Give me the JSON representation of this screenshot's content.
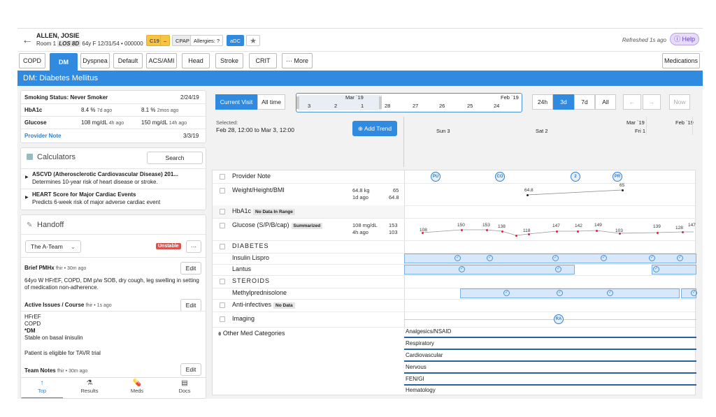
{
  "header": {
    "patient_name": "ALLEN, JOSIE",
    "room": "Room 1",
    "los": "LOS 8D",
    "demographics": "64y F 12/31/54 • 000000",
    "tags": [
      "C19",
      "–",
      "CPAP",
      "Allergies: ?",
      "aDC"
    ],
    "refreshed": "Refreshed 1s ago",
    "help": "Help"
  },
  "tabs": [
    "COPD",
    "DM",
    "Dyspnea",
    "Default",
    "ACS/AMI",
    "Head",
    "Stroke",
    "CRIT",
    "··· More"
  ],
  "medications_button": "Medications",
  "banner": "DM: Diabetes Mellitus",
  "summary": {
    "smoking": "Smoking Status: Never Smoker",
    "smoking_date": "2/24/19",
    "hba1c_label": "HbA1c",
    "hba1c_v1": "8.4 %",
    "hba1c_t1": "7d ago",
    "hba1c_v2": "8.1 %",
    "hba1c_t2": "2mos ago",
    "glucose_label": "Glucose",
    "glucose_v1": "108 mg/dL",
    "glucose_t1": "4h ago",
    "glucose_v2": "150 mg/dL",
    "glucose_t2": "14h ago",
    "provider_note": "Provider Note",
    "provider_date": "3/3/19"
  },
  "calculators": {
    "title": "Calculators",
    "search": "Search",
    "items": [
      {
        "title": "ASCVD (Atherosclerotic Cardiovascular Disease) 201...",
        "desc": "Determines 10-year risk of heart disease or stroke."
      },
      {
        "title": "HEART Score for Major Cardiac Events",
        "desc": "Predicts 6-week risk of major adverse cardiac event"
      }
    ]
  },
  "handoff": {
    "title": "Handoff",
    "team": "The A-Team",
    "status": "Unstable",
    "more": "···",
    "pmhx_label": "Brief PMHx",
    "pmhx_meta": "fhir • 30m ago",
    "pmhx_text": "64yo W HFrEF, COPD, DM p/w SOB, dry cough, leg swelling in setting of medication non-adherence.",
    "issues_label": "Active Issues / Course",
    "issues_meta": "fhir • 1s ago",
    "issues": [
      "HFrEF",
      "COPD",
      "*DM",
      "Stable on basal iinisulin",
      "",
      "Patient is eligible for TAVR trial"
    ],
    "notes_label": "Team Notes",
    "notes_meta": "fhir • 30m ago",
    "edit": "Edit"
  },
  "bottom_nav": [
    "Top",
    "Results",
    "Meds",
    "Docs"
  ],
  "timeline": {
    "current_visit": "Current Visit",
    "all_time": "All time",
    "mar": "Mar `19",
    "feb": "Feb `19",
    "ticks": [
      "3",
      "2",
      "1",
      "28",
      "27",
      "26",
      "25",
      "24"
    ],
    "ranges": [
      "24h",
      "3d",
      "7d",
      "All"
    ],
    "now": "Now",
    "selected_label": "Selected:",
    "selected_range": "Feb 28, 12:00 to Mar 3, 12:00",
    "add_trend": "Add Trend",
    "axis_mar": "Mar `19",
    "axis_feb": "Feb `19",
    "axis_sun": "Sun 3",
    "axis_sat": "Sat 2",
    "axis_fri": "Fri 1"
  },
  "rows": {
    "provider_note": "Provider Note",
    "weight": "Weight/Height/BMI",
    "weight_v1": "64.8 kg",
    "weight_v2": "65",
    "weight_t": "1d ago",
    "weight_v3": "64.8",
    "hba1c": "HbA1c",
    "no_data_range": "No Data In Range",
    "glucose": "Glucose (S/P/B/cap)",
    "summarized": "Summarized",
    "glucose_v1": "108 mg/dL",
    "glucose_v2": "153",
    "glucose_t": "4h ago",
    "glucose_v3": "103",
    "diabetes": "DIABETES",
    "insulin": "Insulin Lispro",
    "lantus": "Lantus",
    "steroids": "STEROIDS",
    "methyl": "Methylprednisolone",
    "antiinf": "Anti-infectives",
    "no_data": "No Data",
    "imaging": "Imaging",
    "other": "Other Med Categories",
    "notes_markers": [
      "PU",
      "CO",
      "2",
      "PR"
    ],
    "imaging_marker": "RA",
    "weight_points": [
      "64.8",
      "65"
    ],
    "glucose_points": [
      "108",
      "150",
      "153",
      "138",
      "118",
      "147",
      "142",
      "149",
      "103",
      "139",
      "128",
      "147"
    ],
    "categories": [
      "Analgesics/NSAID",
      "Respiratory",
      "Cardiovascular",
      "Nervous",
      "FEN/GI",
      "Hematology"
    ]
  }
}
